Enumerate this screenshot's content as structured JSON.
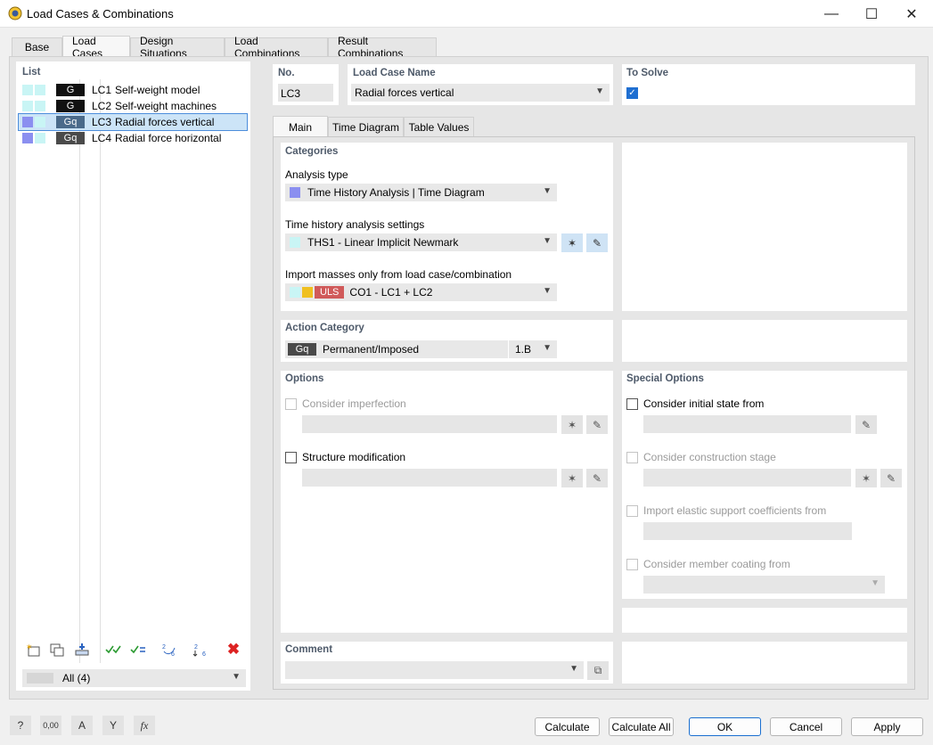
{
  "window": {
    "title": "Load Cases & Combinations",
    "minimize": "—",
    "maximize": "☐",
    "close": "✕"
  },
  "tabs": [
    "Base",
    "Load Cases",
    "Design Situations",
    "Load Combinations",
    "Result Combinations"
  ],
  "list": {
    "label": "List",
    "rows": [
      {
        "cat": "G",
        "no": "LC1",
        "name": "Self-weight model"
      },
      {
        "cat": "G",
        "no": "LC2",
        "name": "Self-weight machines"
      },
      {
        "cat": "Gq",
        "no": "LC3",
        "name": "Radial forces vertical"
      },
      {
        "cat": "Gq",
        "no": "LC4",
        "name": "Radial force horizontal"
      }
    ],
    "filter": "All (4)",
    "delete_glyph": "✖"
  },
  "header": {
    "no_label": "No.",
    "no_value": "LC3",
    "name_label": "Load Case Name",
    "name_value": "Radial forces vertical",
    "solve_label": "To Solve"
  },
  "inner_tabs": [
    "Main",
    "Time Diagram",
    "Table Values"
  ],
  "categories": {
    "label": "Categories",
    "analysis_type_label": "Analysis type",
    "analysis_type_value": "Time History Analysis | Time Diagram",
    "th_settings_label": "Time history analysis settings",
    "th_settings_value": "THS1 - Linear Implicit Newmark",
    "import_masses_label": "Import masses only from load case/combination",
    "import_masses_tag": "ULS",
    "import_masses_value": "CO1 - LC1 + LC2"
  },
  "action": {
    "label": "Action Category",
    "code": "Gq",
    "value": "Permanent/Imposed",
    "sub": "1.B"
  },
  "options": {
    "label": "Options",
    "imperfection": "Consider imperfection",
    "structure_mod": "Structure modification"
  },
  "special": {
    "label": "Special Options",
    "initial_state": "Consider initial state from",
    "construction_stage": "Consider construction stage",
    "elastic_support": "Import elastic support coefficients from",
    "member_coating": "Consider member coating from"
  },
  "comment": {
    "label": "Comment"
  },
  "buttons": {
    "calculate": "Calculate",
    "calculate_all": "Calculate All",
    "ok": "OK",
    "cancel": "Cancel",
    "apply": "Apply"
  },
  "bottom_icons": {
    "help": "?",
    "units": "0,00",
    "display": "A",
    "filter": "Y",
    "formula": "fx"
  },
  "colors": {
    "accent": "#1a6fd0",
    "cat_g": "#111111",
    "cat_gq": "#4a4a4a",
    "uls_tag": "#d05a5a",
    "section_label": "#4e5a6a",
    "swatch_purple": "#8b8ff0",
    "swatch_cyan": "#c9f5f5",
    "swatch_yellow": "#f0c020"
  }
}
